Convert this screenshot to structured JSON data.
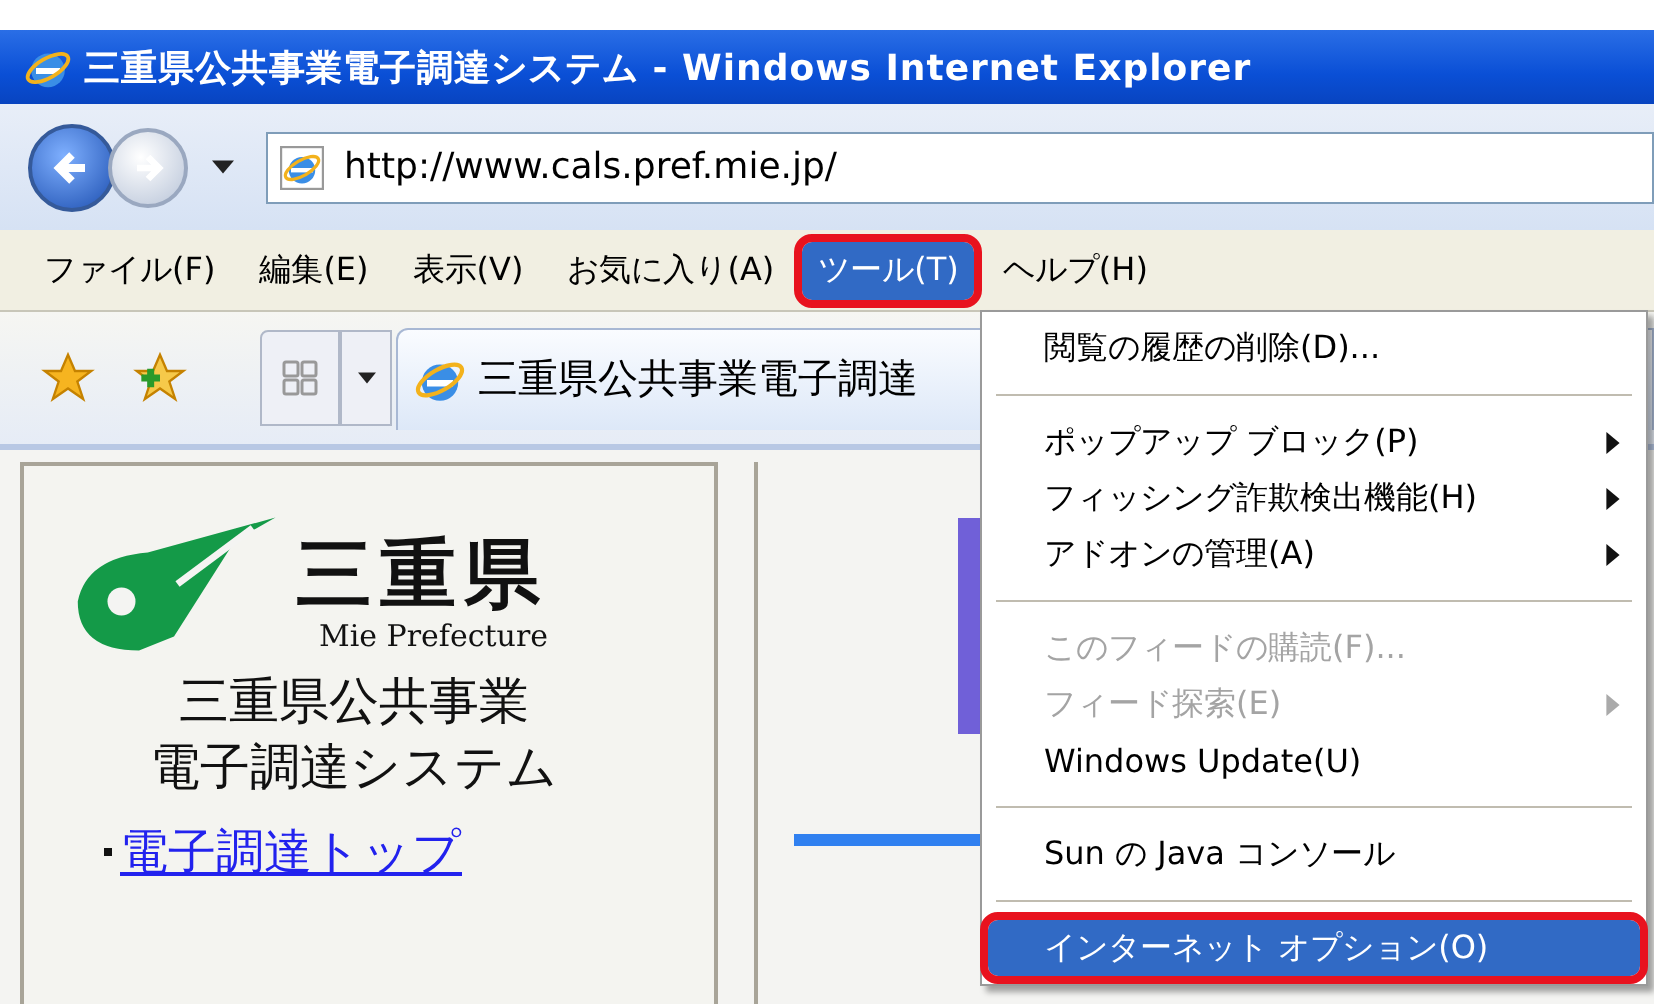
{
  "window": {
    "title": "三重県公共事業電子調達システム - Windows Internet Explorer"
  },
  "address_bar": {
    "value": "http://www.cals.pref.mie.jp/"
  },
  "menu_bar": [
    {
      "label": "ファイル(F)",
      "selected": false,
      "callout": false
    },
    {
      "label": "編集(E)",
      "selected": false,
      "callout": false
    },
    {
      "label": "表示(V)",
      "selected": false,
      "callout": false
    },
    {
      "label": "お気に入り(A)",
      "selected": false,
      "callout": false
    },
    {
      "label": "ツール(T)",
      "selected": true,
      "callout": true
    },
    {
      "label": "ヘルプ(H)",
      "selected": false,
      "callout": false
    }
  ],
  "tab": {
    "title": "三重県公共事業電子調達"
  },
  "sidebar": {
    "logo_name": "三重県",
    "logo_subtitle": "Mie Prefecture",
    "system_title": [
      "三重県公共事業",
      "電子調達システム"
    ],
    "links": [
      {
        "label": "電子調達トップ"
      }
    ]
  },
  "tools_menu": [
    {
      "kind": "item",
      "label": "閲覧の履歴の削除(D)...",
      "disabled": false,
      "submenu": false,
      "selected": false,
      "callout": false
    },
    {
      "kind": "separator"
    },
    {
      "kind": "item",
      "label": "ポップアップ ブロック(P)",
      "disabled": false,
      "submenu": true,
      "selected": false,
      "callout": false
    },
    {
      "kind": "item",
      "label": "フィッシング詐欺検出機能(H)",
      "disabled": false,
      "submenu": true,
      "selected": false,
      "callout": false
    },
    {
      "kind": "item",
      "label": "アドオンの管理(A)",
      "disabled": false,
      "submenu": true,
      "selected": false,
      "callout": false
    },
    {
      "kind": "separator"
    },
    {
      "kind": "item",
      "label": "このフィードの購読(F)...",
      "disabled": true,
      "submenu": false,
      "selected": false,
      "callout": false
    },
    {
      "kind": "item",
      "label": "フィード探索(E)",
      "disabled": true,
      "submenu": true,
      "selected": false,
      "callout": false
    },
    {
      "kind": "item",
      "label": "Windows Update(U)",
      "disabled": false,
      "submenu": false,
      "selected": false,
      "callout": false
    },
    {
      "kind": "separator"
    },
    {
      "kind": "item",
      "label": "Sun の Java コンソール",
      "disabled": false,
      "submenu": false,
      "selected": false,
      "callout": false
    },
    {
      "kind": "separator"
    },
    {
      "kind": "item",
      "label": "インターネット オプション(O)",
      "disabled": false,
      "submenu": false,
      "selected": true,
      "callout": true
    }
  ]
}
